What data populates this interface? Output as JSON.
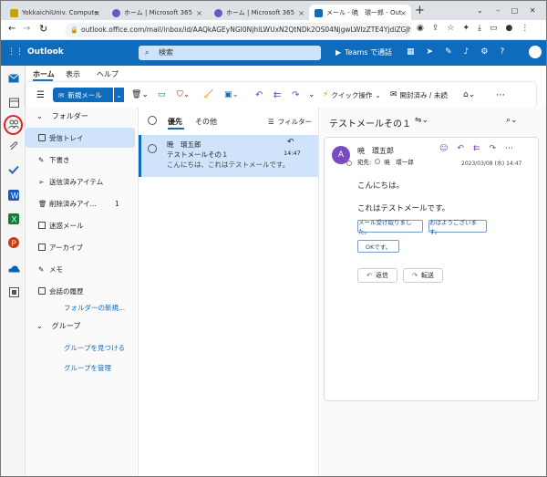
{
  "browser": {
    "tabs": [
      {
        "label": "YokkaichiUniv. Compute",
        "color": "#c8a200"
      },
      {
        "label": "ホーム | Microsoft 365",
        "color": "#5b5fc7"
      },
      {
        "label": "ホーム | Microsoft 365",
        "color": "#5b5fc7"
      },
      {
        "label": "メール - 暁　環一郎 - Out",
        "color": "#0f6cbd"
      }
    ],
    "new_tab": "+",
    "url": "outlook.office.com/mail/inbox/id/AAQkAGEyNGI0NjhlLWUxN2QtNDk2OS04NjgwLWIzZTE4YjdiZGJhY..."
  },
  "app": {
    "name": "Outlook",
    "search_placeholder": "検索",
    "teams_label": "Teams で通話"
  },
  "ribbon": {
    "tabs": [
      "ホーム",
      "表示",
      "ヘルプ"
    ],
    "new_mail": "新規メール",
    "quick_steps": "クイック操作",
    "read_unread": "開封済み / 未読"
  },
  "folders": {
    "header": "フォルダー",
    "items": [
      {
        "label": "受信トレイ",
        "count": ""
      },
      {
        "label": "下書き",
        "count": ""
      },
      {
        "label": "送信済みアイテム",
        "count": ""
      },
      {
        "label": "削除済みアイ...",
        "count": "1"
      },
      {
        "label": "迷惑メール",
        "count": ""
      },
      {
        "label": "アーカイブ",
        "count": ""
      },
      {
        "label": "メモ",
        "count": ""
      },
      {
        "label": "会話の履歴",
        "count": ""
      }
    ],
    "new_folder": "フォルダーの新規...",
    "groups_header": "グループ",
    "find_groups": "グループを見つける",
    "manage_groups": "グループを管理"
  },
  "list": {
    "tab_focused": "優先",
    "tab_other": "その他",
    "filter": "フィルター",
    "message": {
      "sender": "暁　環五郎",
      "subject": "テストメールその１",
      "preview": "こんにちは、これはテストメールです。",
      "time": "14:47"
    }
  },
  "reading": {
    "subject": "テストメールその１",
    "sender": "暁　環五郎",
    "avatar_initial": "A",
    "to_label": "宛先:",
    "to": "暁　環一郎",
    "datetime": "2023/03/08 (水) 14:47",
    "body": [
      "こんにちは。",
      "これはテストメールです。"
    ],
    "quick_replies": [
      "メール受け取りました。",
      "おはようございます。",
      "OKです。"
    ],
    "reply": "返信",
    "forward": "転送"
  },
  "colors": {
    "brand": "#0f6cbd",
    "selected_folder": "#cfe4fa",
    "selected_message": "#cfe4fa",
    "annotation": "#e02020"
  }
}
